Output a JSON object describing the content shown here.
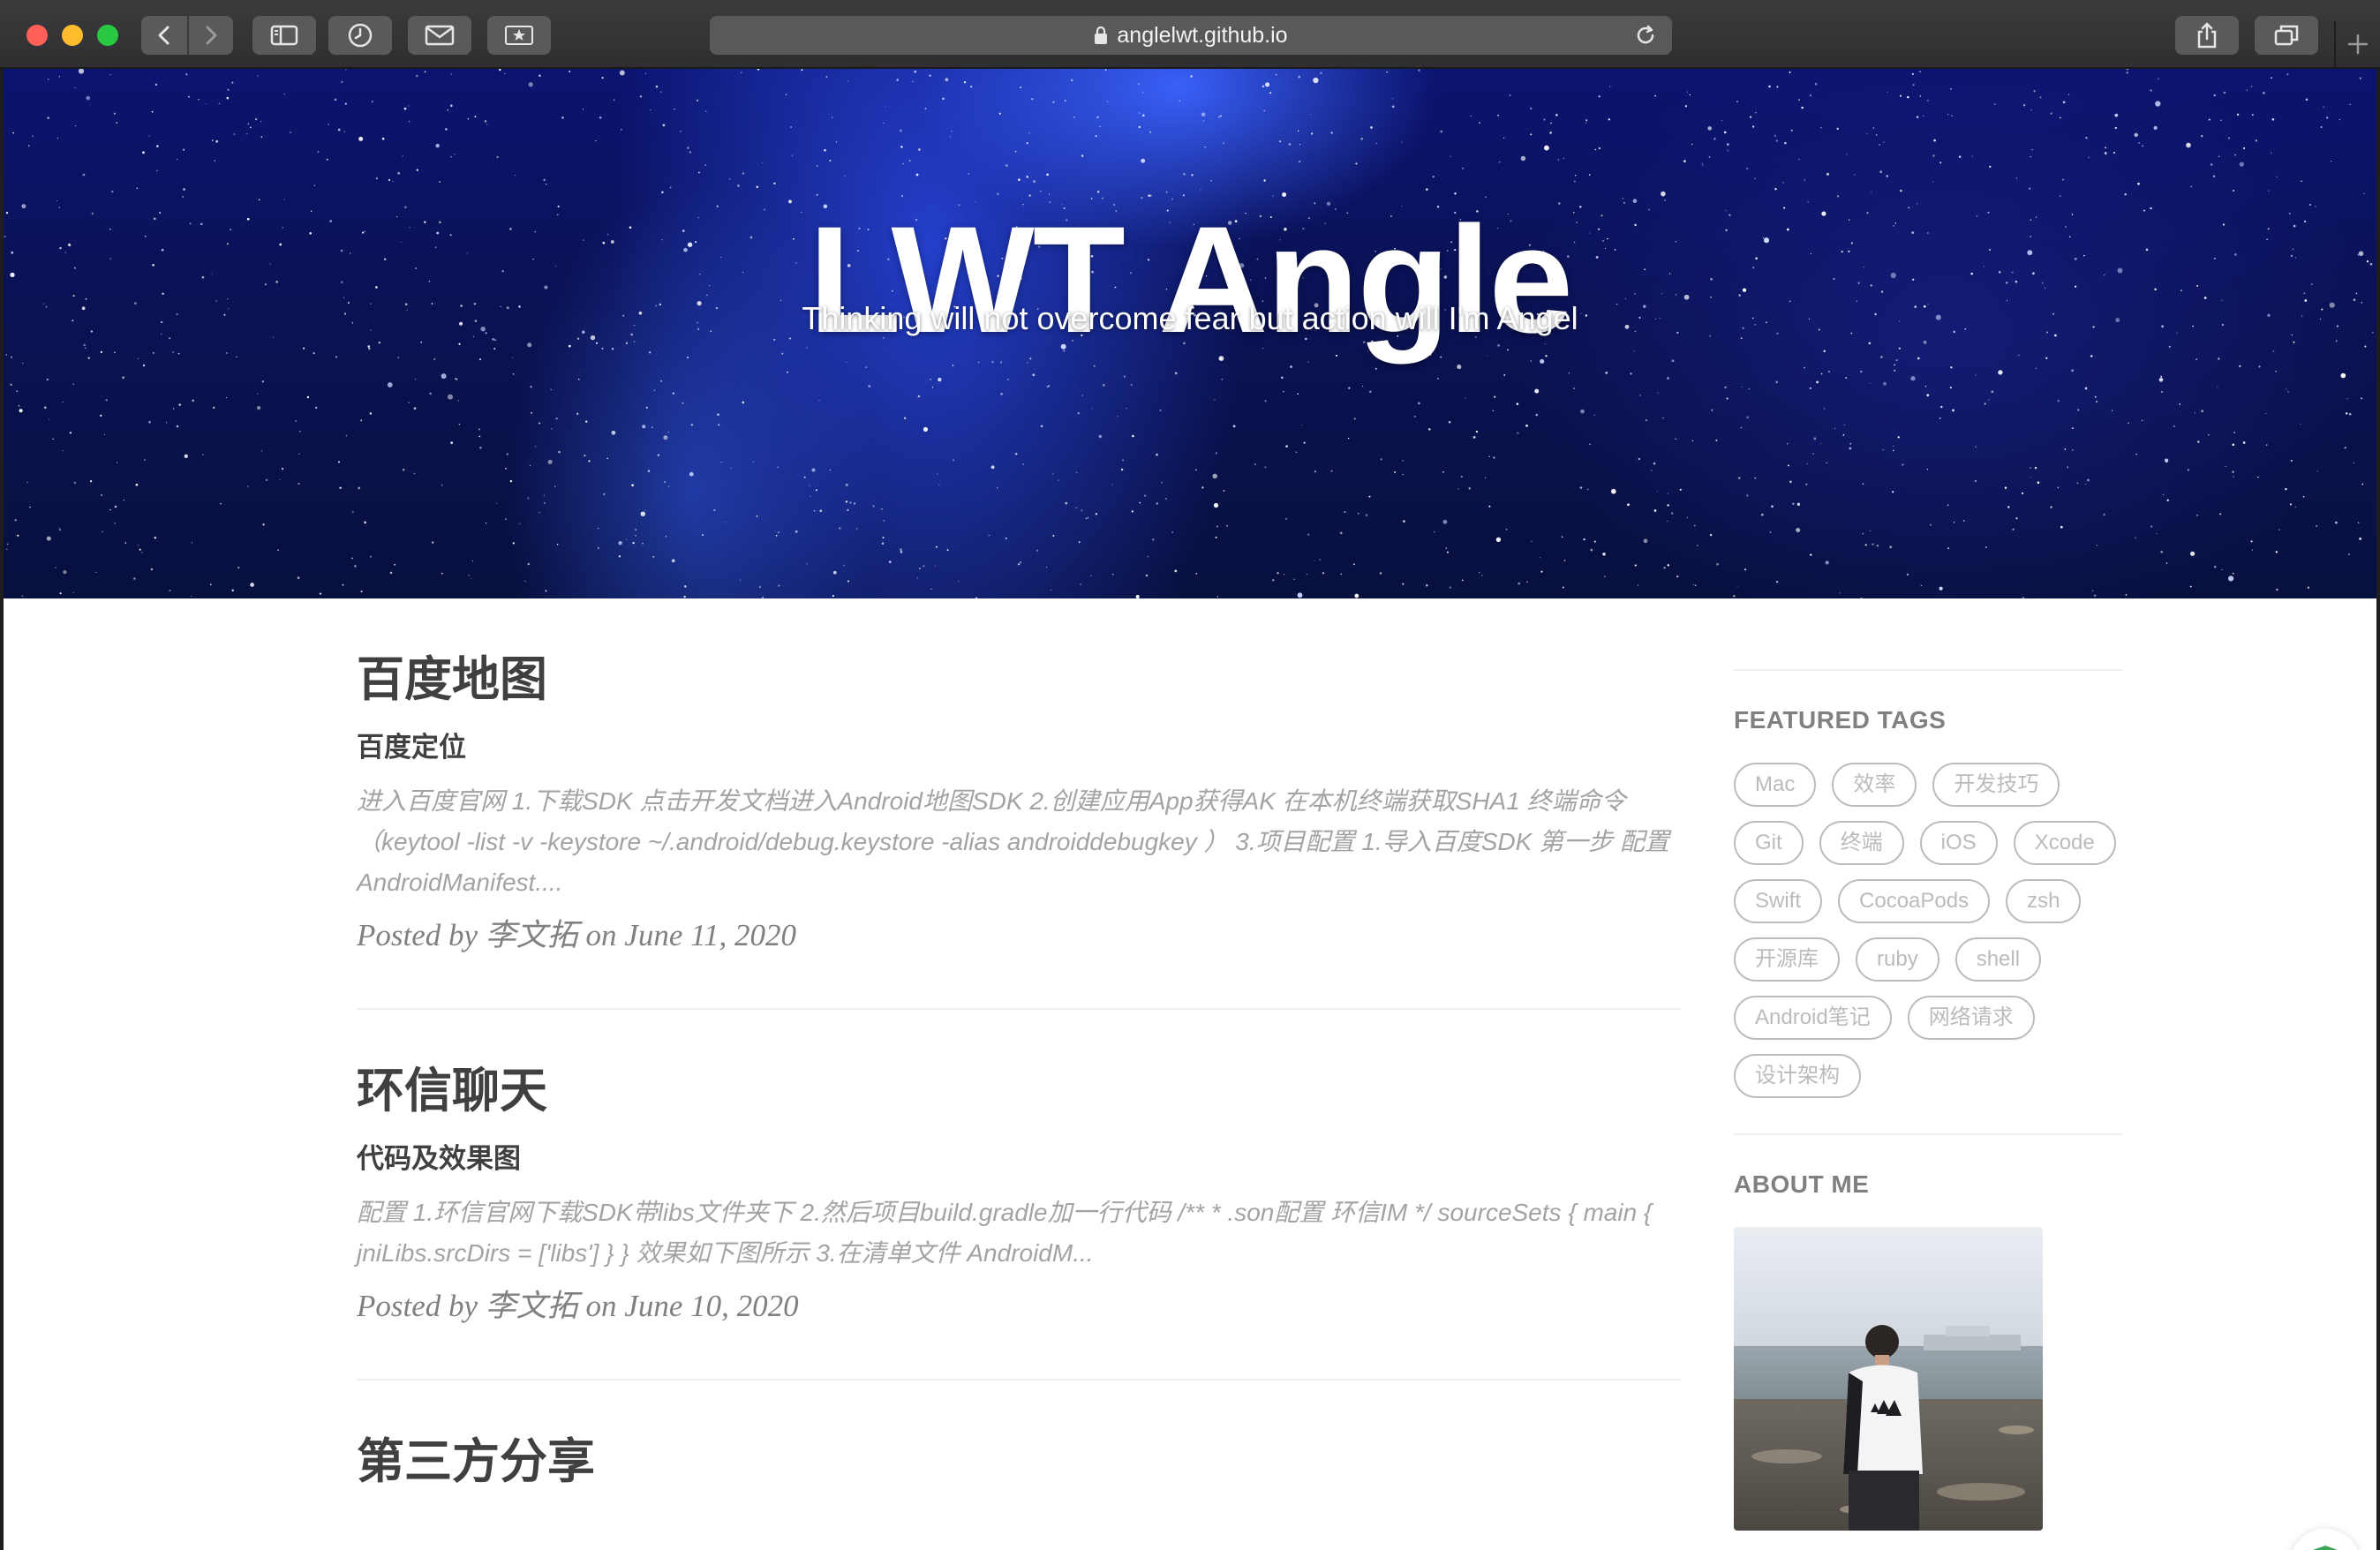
{
  "browser": {
    "url": "anglelwt.github.io",
    "icons": {
      "back": "chevron-left-icon",
      "forward": "chevron-right-icon",
      "sidebar": "sidebar-icon",
      "history": "clock-icon",
      "mail": "envelope-icon",
      "favorites": "star-icon",
      "lock": "lock-icon",
      "reload": "reload-icon",
      "share": "share-icon",
      "tabs": "tabs-overview-icon",
      "new_tab": "plus-icon"
    }
  },
  "hero": {
    "title": "LWT Angle",
    "subtitle": "Thinking will not overcome fear but action will I'm Angel"
  },
  "posts": [
    {
      "title": "百度地图",
      "subtitle": "百度定位",
      "excerpt": "进入百度官网 1.下载SDK 点击开发文档进入Android地图SDK 2.创建应用App获得AK 在本机终端获取SHA1 终端命令（keytool -list -v -keystore ~/.android/debug.keystore -alias androiddebugkey ） 3.项目配置 1.导入百度SDK 第一步 配置AndroidManifest....",
      "meta": "Posted by 李文拓 on June 11, 2020"
    },
    {
      "title": "环信聊天",
      "subtitle": "代码及效果图",
      "excerpt": "配置 1.环信官网下载SDK带libs文件夹下 2.然后项目build.gradle加一行代码 /** * .son配置 环信IM */ sourceSets { main { jniLibs.srcDirs = ['libs'] } } 效果如下图所示 3.在清单文件 AndroidM...",
      "meta": "Posted by 李文拓 on June 10, 2020"
    },
    {
      "title": "第三方分享"
    }
  ],
  "sidebar": {
    "featured_tags_heading": "FEATURED TAGS",
    "tags": [
      "Mac",
      "效率",
      "开发技巧",
      "Git",
      "终端",
      "iOS",
      "Xcode",
      "Swift",
      "CocoaPods",
      "zsh",
      "开源库",
      "ruby",
      "shell",
      "Android笔记",
      "网络请求",
      "设计架构"
    ],
    "about_heading": "ABOUT ME"
  },
  "badge": {
    "icon": "shield-check-icon",
    "color": "#3aa757"
  },
  "colors": {
    "accent_blue": "#1b2fd0",
    "text_dark": "#404040",
    "muted": "#a3a3a3"
  }
}
